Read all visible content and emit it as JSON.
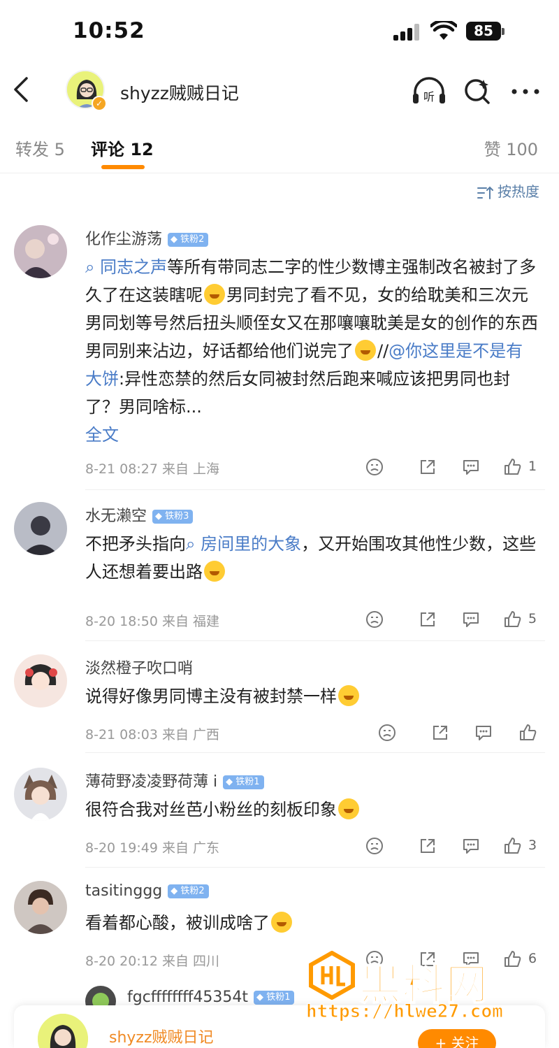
{
  "status": {
    "time": "10:52",
    "battery": "85"
  },
  "header": {
    "title": "shyzz贼贼日记",
    "listen_label": "听"
  },
  "tabs": {
    "repost": "转发 5",
    "comments": "评论 12",
    "likes": "赞 100"
  },
  "sort": {
    "label": "按热度"
  },
  "comments": [
    {
      "name": "化作尘游荡",
      "badge": "铁粉2",
      "topic": "同志之声",
      "text_a": "等所有带同志二字的性少数博主强制改名被封了多久了在这装瞎呢",
      "text_b": "男同封完了看不见，女的给耽美和三次元男同划等号然后扭头顺侄女又在那嚷嚷耽美是女的创作的东西男同别来沾边，好话都给他们说完了",
      "text_c": "//",
      "mention": "@你这里是不是有大饼",
      "text_d": ":异性恋禁的然后女同被封然后跑来喊应该把男同也封了？男同啥标...",
      "full_text": "全文",
      "meta": "8-21 08:27  来自 上海",
      "likes": "1",
      "avatar_color": "#b7a7b0"
    },
    {
      "name": "水无濑空",
      "badge": "铁粉3",
      "text_a": "不把矛头指向",
      "topic": "房间里的大象",
      "text_b": "，又开始围攻其他性少数，这些人还想着要出路",
      "meta": "8-20 18:50  来自 福建",
      "likes": "5",
      "avatar_color": "#8c8f99"
    },
    {
      "name": "淡然橙子吹口哨",
      "text_a": "说得好像男同博主没有被封禁一样",
      "meta": "8-21 08:03  来自 广西",
      "likes": "",
      "avatar_color": "#f3d9d2"
    },
    {
      "name": "薄荷野凌凌野荷薄 i",
      "badge": "铁粉1",
      "text_a": "很符合我对丝芭小粉丝的刻板印象",
      "meta": "8-20 19:49  来自 广东",
      "likes": "3",
      "avatar_color": "#dcdde2"
    },
    {
      "name": "tasitinggg",
      "badge": "铁粉2",
      "text_a": "看着都心酸，被训成啥了",
      "meta": "8-20 20:12  来自 四川",
      "likes": "6",
      "avatar_color": "#6b5e5a"
    },
    {
      "name": "fgcffffffff45354t",
      "badge": "铁粉1",
      "avatar_color": "#4a4a4a"
    }
  ],
  "bottom": {
    "name": "shyzz贼贼日记",
    "follow": "+ 关注"
  },
  "watermark": {
    "text": "黑料网",
    "url": "https://hlwe27.com"
  }
}
